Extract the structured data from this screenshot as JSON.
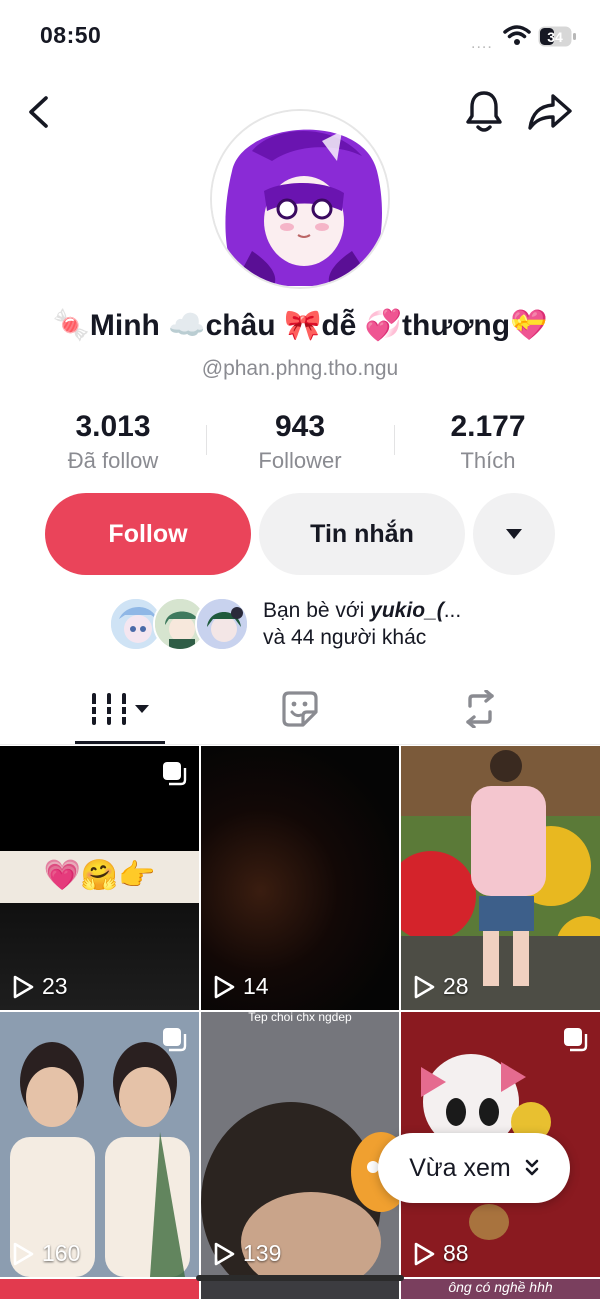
{
  "status_bar": {
    "time": "08:50",
    "signal": "....",
    "battery_level": "34",
    "icons": [
      "wifi-icon",
      "battery-icon"
    ]
  },
  "nav": {
    "icons": [
      "back-icon",
      "bell-icon",
      "share-icon"
    ]
  },
  "profile": {
    "display_name_parts": [
      "Minh",
      "châu",
      "dễ",
      "thương"
    ],
    "display_name_emojis": [
      "🍬",
      "☁️",
      "🎀",
      "💞",
      "💝"
    ],
    "handle": "@phan.phng.tho.ngu"
  },
  "stats": [
    {
      "value": "3.013",
      "label": "Đã follow"
    },
    {
      "value": "943",
      "label": "Follower"
    },
    {
      "value": "2.177",
      "label": "Thích"
    }
  ],
  "actions": {
    "follow_label": "Follow",
    "message_label": "Tin nhắn",
    "more_icon": "caret-down-icon"
  },
  "friends": {
    "prefix": "Bạn bè với ",
    "name": "yukio_(",
    "ellipsis": "...",
    "line2": "và 44 người khác"
  },
  "tabs": [
    {
      "name": "videos",
      "icon": "grid-icon",
      "selected": true
    },
    {
      "name": "stickers",
      "icon": "sticker-icon",
      "selected": false
    },
    {
      "name": "reposts",
      "icon": "repost-icon",
      "selected": false
    }
  ],
  "grid": [
    {
      "views": "23",
      "multi": true,
      "caption_emojis": "💗🤗👉"
    },
    {
      "views": "14",
      "multi": false
    },
    {
      "views": "28",
      "multi": false
    },
    {
      "views": "160",
      "multi": true
    },
    {
      "views": "139",
      "multi": false,
      "caption": "Tep choi chx ngdep"
    },
    {
      "views": "88",
      "multi": true
    }
  ],
  "bottom_captions": [
    "ông có nghề hhh"
  ],
  "recent_pill": {
    "label": "Vừa xem"
  },
  "colors": {
    "follow": "#ea445a",
    "secondary_button": "#f1f1f2",
    "muted_text": "#8a8b91"
  }
}
